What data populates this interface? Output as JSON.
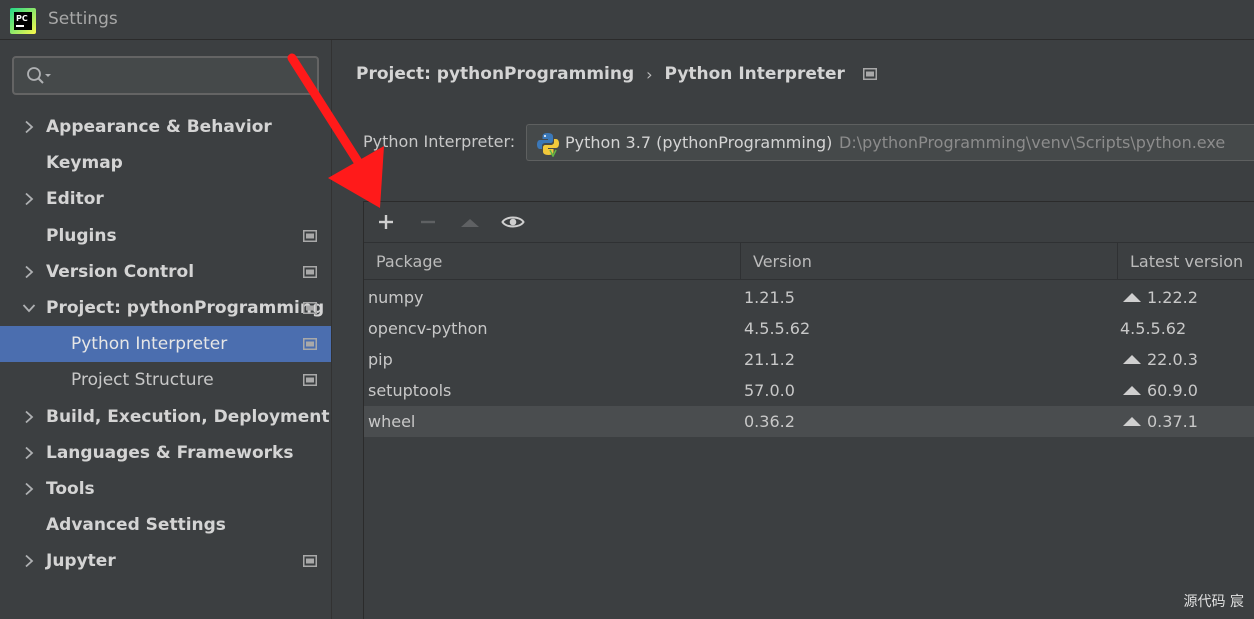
{
  "window": {
    "title": "Settings",
    "logo_text": "PC"
  },
  "search": {
    "value": "",
    "placeholder": ""
  },
  "sidebar": {
    "items": [
      {
        "label": "Appearance & Behavior",
        "expandable": true
      },
      {
        "label": "Keymap",
        "expandable": false
      },
      {
        "label": "Editor",
        "expandable": true
      },
      {
        "label": "Plugins",
        "expandable": false
      },
      {
        "label": "Version Control",
        "expandable": true
      },
      {
        "label": "Project: pythonProgramming",
        "expandable": true,
        "expanded": true
      },
      {
        "label": "Python Interpreter",
        "sub": true,
        "selected": true
      },
      {
        "label": "Project Structure",
        "sub": true
      },
      {
        "label": "Build, Execution, Deployment",
        "expandable": true
      },
      {
        "label": "Languages & Frameworks",
        "expandable": true
      },
      {
        "label": "Tools",
        "expandable": true
      },
      {
        "label": "Advanced Settings",
        "expandable": false
      },
      {
        "label": "Jupyter",
        "expandable": true
      }
    ]
  },
  "breadcrumb": {
    "project": "Project: pythonProgramming",
    "separator": "›",
    "page": "Python Interpreter"
  },
  "interpreter": {
    "label": "Python Interpreter:",
    "name": "Python 3.7 (pythonProgramming)",
    "path": "D:\\pythonProgramming\\venv\\Scripts\\python.exe"
  },
  "packages": {
    "columns": {
      "package": "Package",
      "version": "Version",
      "latest": "Latest version"
    },
    "rows": [
      {
        "name": "numpy",
        "version": "1.21.5",
        "latest": "1.22.2",
        "upgradable": true
      },
      {
        "name": "opencv-python",
        "version": "4.5.5.62",
        "latest": "4.5.5.62",
        "upgradable": false
      },
      {
        "name": "pip",
        "version": "21.1.2",
        "latest": "22.0.3",
        "upgradable": true
      },
      {
        "name": "setuptools",
        "version": "57.0.0",
        "latest": "60.9.0",
        "upgradable": true
      },
      {
        "name": "wheel",
        "version": "0.36.2",
        "latest": "0.37.1",
        "upgradable": true
      }
    ]
  },
  "watermark": "源代码 宸",
  "colors": {
    "accent": "#4b6eaf",
    "annotation": "#ff1a1a"
  }
}
